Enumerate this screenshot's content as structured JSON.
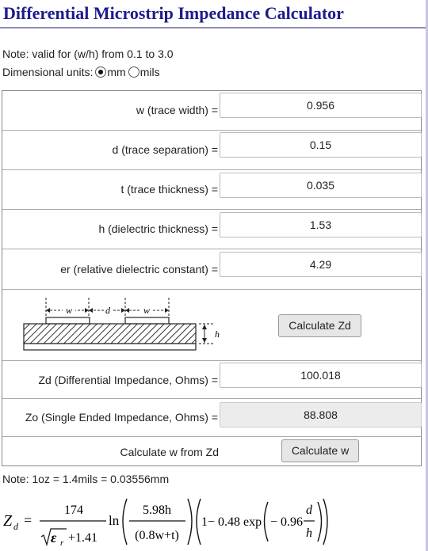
{
  "title": "Differential Microstrip Impedance Calculator",
  "note_validity": "Note: valid for (w/h) from 0.1 to 3.0",
  "units": {
    "label": "Dimensional units:",
    "options": [
      "mm",
      "mils"
    ],
    "selected": "mm"
  },
  "fields": {
    "w": {
      "label": "w (trace width) =",
      "value": "0.956"
    },
    "d": {
      "label": "d (trace separation) =",
      "value": "0.15"
    },
    "t": {
      "label": "t (trace thickness) =",
      "value": "0.035"
    },
    "h": {
      "label": "h (dielectric thickness) =",
      "value": "1.53"
    },
    "er": {
      "label": "er (relative dielectric constant) =",
      "value": "4.29"
    }
  },
  "diagram_labels": {
    "w": "w",
    "d": "d",
    "h": "h"
  },
  "calculate_zd_label": "Calculate Zd",
  "results": {
    "zd": {
      "label": "Zd (Differential Impedance, Ohms) =",
      "value": "100.018"
    },
    "zo": {
      "label": "Zo (Single Ended Impedance, Ohms) =",
      "value": "88.808"
    }
  },
  "calc_w": {
    "label": "Calculate w from Zd",
    "button": "Calculate w"
  },
  "note_oz": "Note: 1oz = 1.4mils = 0.03556mm",
  "formula": {
    "lhs": "Z",
    "lhs_sub": "d",
    "coef_num": "174",
    "coef_den_eps": "ε",
    "coef_den_sub": "r",
    "coef_den_add": "+1.41",
    "ln": "ln",
    "frac1_num": "5.98h",
    "frac1_den": "(0.8w+t)",
    "factor": "1− 0.48 exp",
    "exp_coef": "− 0.96",
    "frac2_num": "d",
    "frac2_den": "h"
  }
}
